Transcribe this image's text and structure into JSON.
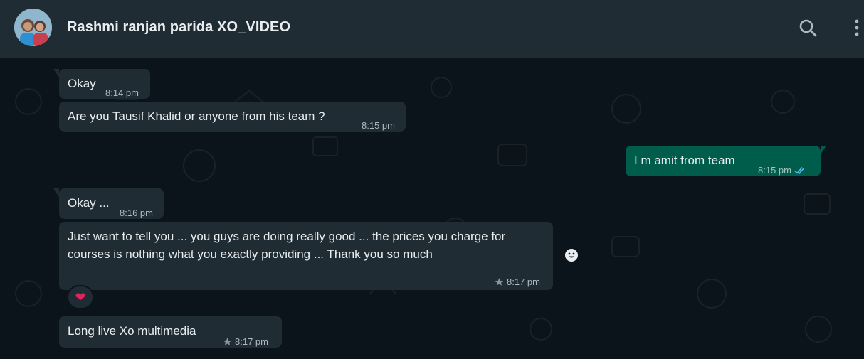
{
  "header": {
    "contact_name": "Rashmi ranjan parida XO_VIDEO",
    "icons": [
      "search-icon",
      "menu-icon"
    ]
  },
  "messages": [
    {
      "direction": "incoming",
      "text": "Okay",
      "time": "8:14 pm",
      "starred": false
    },
    {
      "direction": "incoming",
      "text": "Are you Tausif Khalid or anyone from his team ?",
      "time": "8:15 pm",
      "starred": false
    },
    {
      "direction": "outgoing",
      "text": "I m amit from team",
      "time": "8:15 pm",
      "status": "read"
    },
    {
      "direction": "incoming",
      "text": "Okay ...",
      "time": "8:16 pm",
      "starred": false
    },
    {
      "direction": "incoming",
      "text": "Just want to tell you ... you guys are doing really good ... the prices you charge for courses is nothing what you exactly providing ... Thank you so much",
      "time": "8:17 pm",
      "starred": true,
      "reaction": "❤"
    },
    {
      "direction": "incoming",
      "text": "Long live Xo multimedia",
      "time": "8:17 pm",
      "starred": true
    }
  ],
  "colors": {
    "header_bg": "#202c33",
    "chat_bg": "#0b141a",
    "incoming_bubble": "#202c33",
    "outgoing_bubble": "#005c4b",
    "read_ticks": "#53bdeb"
  }
}
